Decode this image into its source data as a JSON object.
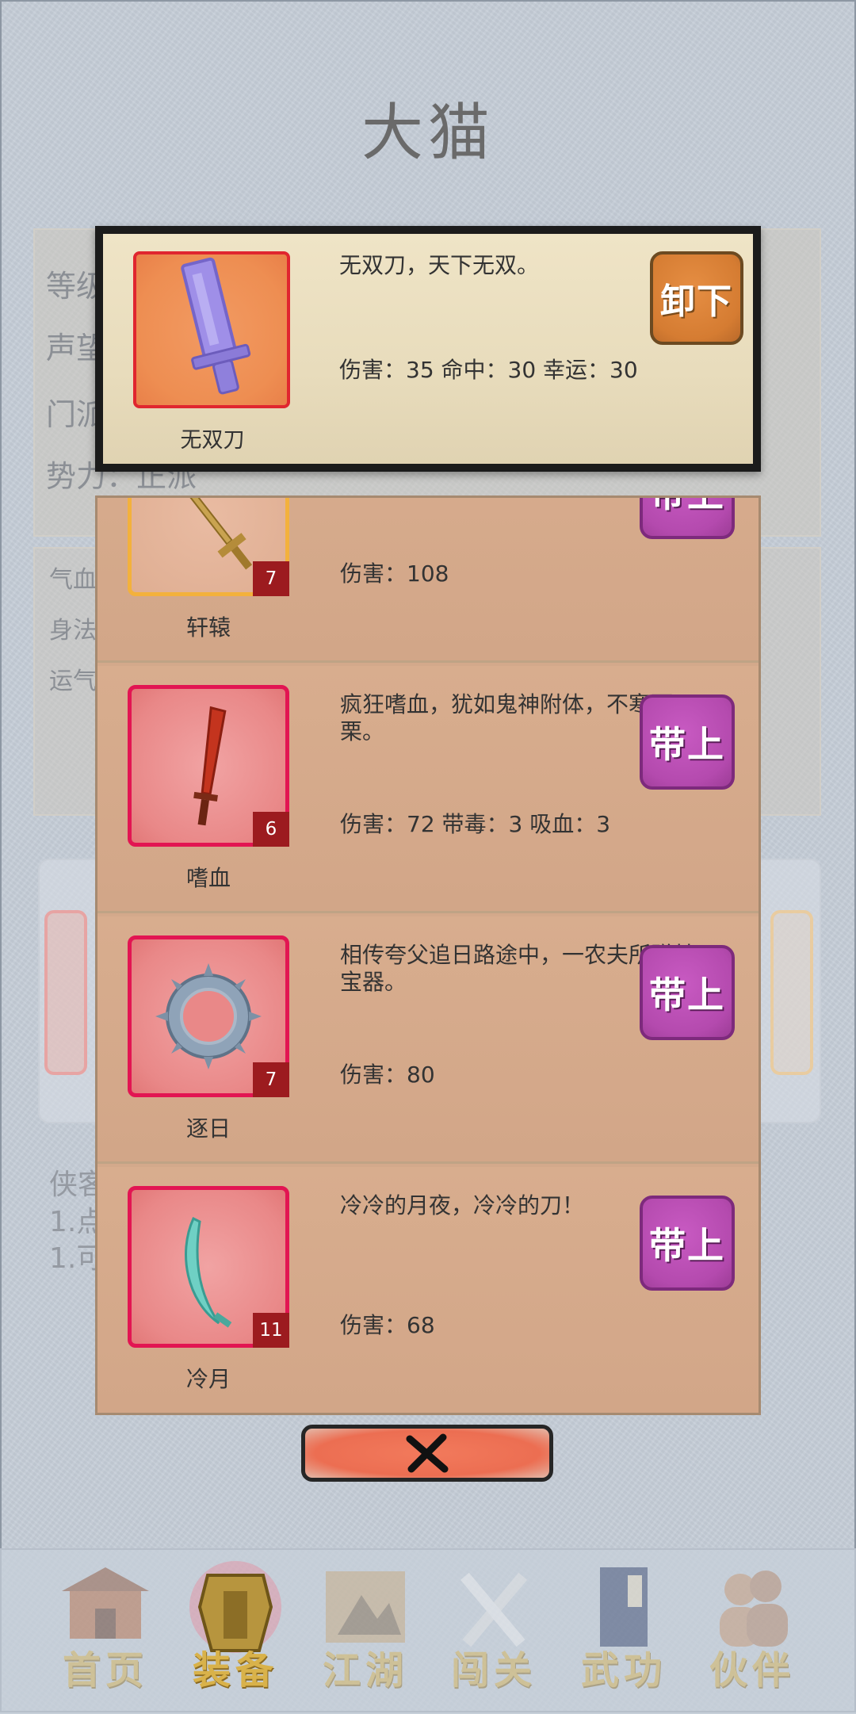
{
  "page": {
    "character_name": "大猫"
  },
  "background_stats": {
    "lines": [
      "等级",
      "声望",
      "门派",
      "势力：正派"
    ],
    "small_lines": [
      "气血",
      "身法",
      "运气"
    ],
    "info_lines": [
      "侠客",
      "1.点",
      "1.可"
    ]
  },
  "equipped": {
    "name": "无双刀",
    "description": "无双刀，天下无双。",
    "stats": "伤害：35 命中：30 幸运：30",
    "action_label": "卸下"
  },
  "weapons": [
    {
      "name": "轩辕",
      "level": "7",
      "description": "",
      "stats": "伤害：108",
      "action_label": "带上",
      "frame": "gold"
    },
    {
      "name": "嗜血",
      "level": "6",
      "description": "疯狂嗜血，犹如鬼神附体，不寒而栗。",
      "stats": "伤害：72 带毒：3 吸血：3",
      "action_label": "带上",
      "frame": "red"
    },
    {
      "name": "逐日",
      "level": "7",
      "description": "相传夸父追日路途中，一农夫所赠其宝器。",
      "stats": "伤害：80",
      "action_label": "带上",
      "frame": "red"
    },
    {
      "name": "冷月",
      "level": "11",
      "description": "冷冷的月夜，冷冷的刀！",
      "stats": "伤害：68",
      "action_label": "带上",
      "frame": "red"
    }
  ],
  "close_button": {
    "icon": "close-x-icon"
  },
  "nav": [
    {
      "label": "首页",
      "icon": "house-icon",
      "active": false
    },
    {
      "label": "装备",
      "icon": "armor-icon",
      "active": true
    },
    {
      "label": "江湖",
      "icon": "scroll-map-icon",
      "active": false
    },
    {
      "label": "闯关",
      "icon": "crossed-swords-icon",
      "active": false
    },
    {
      "label": "武功",
      "icon": "book-icon",
      "active": false
    },
    {
      "label": "伙伴",
      "icon": "companions-icon",
      "active": false
    }
  ],
  "colors": {
    "unequip_button": "#d57c32",
    "equip_button": "#b44aae",
    "level_badge": "#9c1b1f",
    "nav_label": "#d9b24a"
  }
}
